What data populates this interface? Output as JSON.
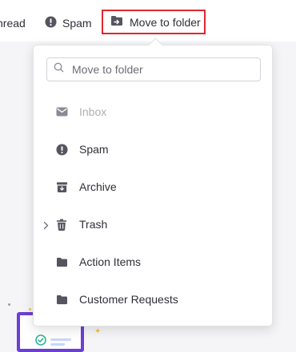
{
  "toolbar": {
    "unread_label": "nread",
    "spam_label": "Spam",
    "move_label": "Move to folder"
  },
  "dropdown": {
    "search_placeholder": "Move to folder",
    "items": [
      {
        "label": "Inbox",
        "icon": "envelope-icon",
        "disabled": true
      },
      {
        "label": "Spam",
        "icon": "spam-icon"
      },
      {
        "label": "Archive",
        "icon": "archive-icon"
      },
      {
        "label": "Trash",
        "icon": "trash-icon",
        "has_submenu": true
      },
      {
        "label": "Action Items",
        "icon": "folder-icon"
      },
      {
        "label": "Customer Requests",
        "icon": "folder-icon"
      }
    ]
  },
  "colors": {
    "highlight_border": "#e0262f",
    "accent": "#6b3fd6",
    "icon": "#55555f",
    "disabled_text": "#aeaeb6"
  }
}
